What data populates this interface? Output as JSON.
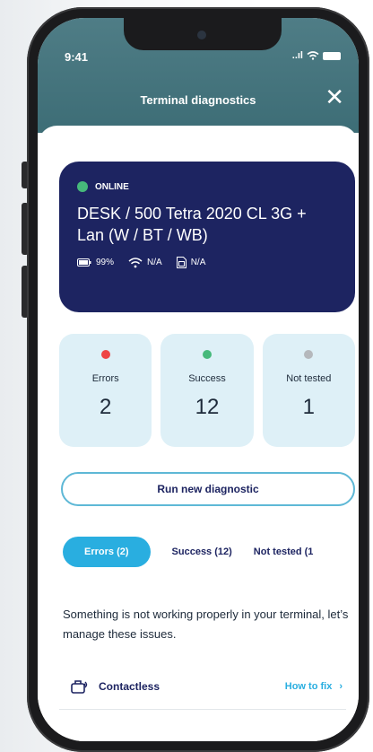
{
  "status_bar": {
    "time": "9:41",
    "signal": "..ıl"
  },
  "header": {
    "title": "Terminal diagnostics"
  },
  "icons": {
    "close": "close-icon",
    "battery": "battery-icon",
    "wifi": "wifi-icon",
    "sim": "sim-card-icon",
    "contactless": "contactless-card-icon",
    "chevron": "chevron-right-icon"
  },
  "terminal": {
    "status": "ONLINE",
    "name": "DESK / 500 Tetra 2020 CL 3G + Lan (W / BT / WB)",
    "battery": "99%",
    "wifi": "N/A",
    "sim": "N/A"
  },
  "stats": [
    {
      "label": "Errors",
      "value": "2",
      "color": "#ee4444"
    },
    {
      "label": "Success",
      "value": "12",
      "color": "#46b97b"
    },
    {
      "label": "Not tested",
      "value": "1",
      "color": "#b5b8bc"
    }
  ],
  "actions": {
    "run_label": "Run new diagnostic"
  },
  "tabs": [
    {
      "label": "Errors (2)",
      "active": true
    },
    {
      "label": "Success (12)",
      "active": false
    },
    {
      "label": "Not tested (1",
      "active": false
    }
  ],
  "description": "Something is not working properly in your terminal, let’s manage these issues.",
  "issues": [
    {
      "name": "Contactless",
      "action": "How to fix"
    }
  ],
  "colors": {
    "header_bg": "#4f7d86",
    "card_bg": "#1d2461",
    "stat_bg": "#def0f7",
    "accent": "#29aee0",
    "online": "#46b97b"
  }
}
